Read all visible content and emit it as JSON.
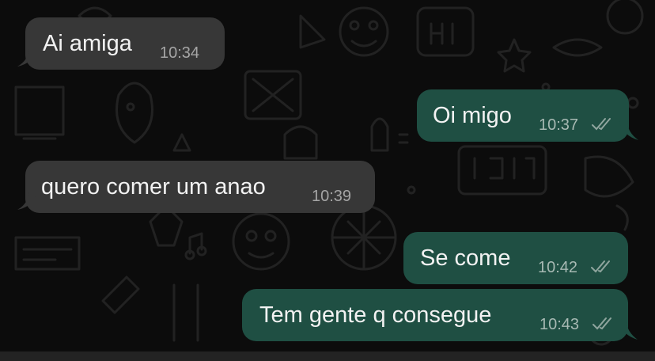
{
  "conversation": {
    "messages": [
      {
        "direction": "incoming",
        "text": "Ai amiga",
        "time": "10:34"
      },
      {
        "direction": "outgoing",
        "text": "Oi migo",
        "time": "10:37",
        "status": "read-double-check-icon"
      },
      {
        "direction": "incoming",
        "text": "quero comer um anao",
        "time": "10:39"
      },
      {
        "direction": "outgoing",
        "text": "Se come",
        "time": "10:42",
        "status": "read-double-check-icon"
      },
      {
        "direction": "outgoing",
        "text": "Tem gente q consegue",
        "time": "10:43",
        "status": "read-double-check-icon"
      }
    ]
  },
  "colors": {
    "background": "#0c0c0c",
    "incoming_bubble": "#373737",
    "outgoing_bubble": "#1f4f43",
    "timestamp": "#a5a5a5",
    "text": "#f2f2f2"
  }
}
